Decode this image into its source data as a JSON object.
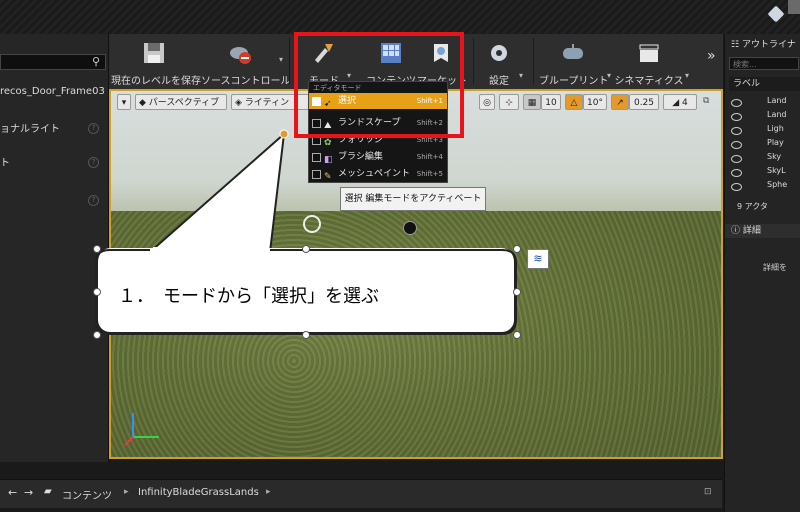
{
  "left_panel": {
    "items": [
      "recos_Door_Frame03",
      "ョナルライト",
      "ト"
    ]
  },
  "toolbar": {
    "buttons": [
      {
        "label": "現在のレベルを保存"
      },
      {
        "label": "ソースコントロール"
      },
      {
        "label": "モード"
      },
      {
        "label": "コンテンツ"
      },
      {
        "label": "マーケット"
      },
      {
        "label": "設定"
      },
      {
        "label": "ブループリント"
      },
      {
        "label": "シネマティクス"
      }
    ],
    "more": "»"
  },
  "viewport_toolbar": {
    "perspective": "パースペクティブ",
    "lighting": "ライティン",
    "grid_snap": "10",
    "rot_snap": "10°",
    "scale_snap": "0.25",
    "camera_speed": "4"
  },
  "mode_menu": {
    "header": "エディタモード",
    "items": [
      {
        "name": "選択",
        "shortcut": "Shift+1",
        "checked": true
      },
      {
        "name": "ランドスケープ",
        "shortcut": "Shift+2",
        "checked": false
      },
      {
        "name": "フォリッジ",
        "shortcut": "Shift+3",
        "checked": false
      },
      {
        "name": "ブラシ編集",
        "shortcut": "Shift+4",
        "checked": false
      },
      {
        "name": "メッシュペイント",
        "shortcut": "Shift+5",
        "checked": false
      }
    ]
  },
  "tooltip": "選択 編集モードをアクティベート",
  "callout": {
    "text": "１．　モードから「選択」を選ぶ"
  },
  "outliner": {
    "title": "アウトライナ",
    "search_placeholder": "検索...",
    "column": "ラベル",
    "items": [
      "Land",
      "Land",
      "Ligh",
      "Play",
      "Sky",
      "SkyL",
      "Sphe"
    ],
    "count": "9 アクタ"
  },
  "details": {
    "title": "詳細",
    "hint": "詳細を"
  },
  "bottom": {
    "crumbs": [
      "コンテンツ",
      "InfinityBladeGrassLands"
    ]
  },
  "colors": {
    "highlight": "#e8141a",
    "selected_row": "#e6a117",
    "viewport_border": "#c9a227"
  }
}
